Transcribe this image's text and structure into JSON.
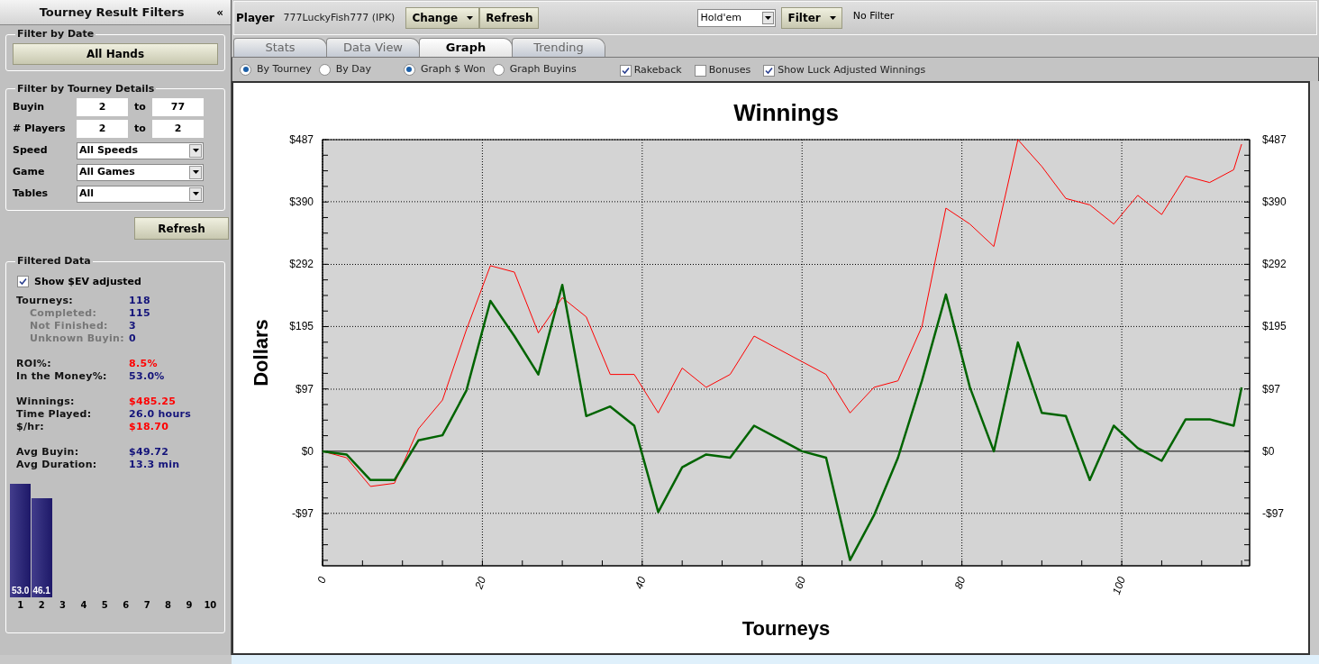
{
  "sidebar": {
    "title": "Tourney Result Filters",
    "collapse_icon": "«",
    "date_filter": {
      "legend": "Filter by Date",
      "button": "All Hands"
    },
    "details": {
      "legend": "Filter by Tourney Details",
      "ranges": [
        {
          "label": "Buyin",
          "from": "2",
          "to_label": "to",
          "to": "77"
        },
        {
          "label": "# Players",
          "from": "2",
          "to_label": "to",
          "to": "2"
        }
      ],
      "dropdowns": [
        {
          "label": "Speed",
          "value": "All Speeds"
        },
        {
          "label": "Game",
          "value": "All Games"
        },
        {
          "label": "Tables",
          "value": "All"
        }
      ]
    },
    "refresh_button": "Refresh",
    "filtered": {
      "legend": "Filtered Data",
      "ev_checkbox": {
        "label": "Show $EV adjusted",
        "checked": true
      },
      "groups": [
        [
          {
            "kind": "main",
            "label": "Tourneys:",
            "value": "118",
            "color": "#14147a"
          },
          {
            "kind": "sub",
            "label": "Completed:",
            "value": "115",
            "color": "#14147a"
          },
          {
            "kind": "sub",
            "label": "Not Finished:",
            "value": "3",
            "color": "#14147a"
          },
          {
            "kind": "sub",
            "label": "Unknown Buyin:",
            "value": "0",
            "color": "#14147a"
          }
        ],
        [
          {
            "kind": "main",
            "label": "ROI%:",
            "value": "8.5%",
            "color": "#ff0000"
          },
          {
            "kind": "main",
            "label": "In the Money%:",
            "value": "53.0%",
            "color": "#14147a"
          }
        ],
        [
          {
            "kind": "main",
            "label": "Winnings:",
            "value": "$485.25",
            "color": "#ff0000"
          },
          {
            "kind": "main",
            "label": "Time Played:",
            "value": "26.0 hours",
            "color": "#14147a"
          },
          {
            "kind": "main",
            "label": "$/hr:",
            "value": "$18.70",
            "color": "#ff0000"
          }
        ],
        [
          {
            "kind": "main",
            "label": "Avg Buyin:",
            "value": "$49.72",
            "color": "#14147a"
          },
          {
            "kind": "main",
            "label": "Avg Duration:",
            "value": "13.3 min",
            "color": "#14147a"
          }
        ]
      ],
      "chart_data": {
        "type": "bar",
        "categories": [
          "1",
          "2",
          "3",
          "4",
          "5",
          "6",
          "7",
          "8",
          "9",
          "10"
        ],
        "values": [
          53.0,
          46.1,
          null,
          null,
          null,
          null,
          null,
          null,
          null,
          null
        ],
        "value_labels": [
          "53.0",
          "46.1",
          null,
          null,
          null,
          null,
          null,
          null,
          null,
          null
        ]
      }
    }
  },
  "player_bar": {
    "label": "Player",
    "player": "777LuckyFish777 (IPK)",
    "change_button": "Change",
    "refresh_button": "Refresh",
    "game_select": "Hold'em",
    "filter_button": "Filter",
    "filter_status": "No Filter"
  },
  "tabs": [
    {
      "label": "Stats",
      "selected": false
    },
    {
      "label": "Data View",
      "selected": false
    },
    {
      "label": "Graph",
      "selected": true
    },
    {
      "label": "Trending",
      "selected": false
    }
  ],
  "radio_groups": [
    [
      {
        "label": "By Tourney",
        "selected": true
      },
      {
        "label": "By Day",
        "selected": false
      }
    ],
    [
      {
        "label": "Graph $ Won",
        "selected": true
      },
      {
        "label": "Graph Buyins",
        "selected": false
      }
    ]
  ],
  "checkboxes": [
    {
      "label": "Rakeback",
      "checked": true
    },
    {
      "label": "Bonuses",
      "checked": false
    },
    {
      "label": "Show Luck Adjusted Winnings",
      "checked": true
    }
  ],
  "graph": {
    "chart_data": {
      "type": "line",
      "title": "Winnings",
      "xlabel": "Tourneys",
      "ylabel": "Dollars",
      "x": [
        0,
        3,
        6,
        9,
        12,
        15,
        18,
        21,
        24,
        27,
        30,
        33,
        36,
        39,
        42,
        45,
        48,
        51,
        54,
        57,
        60,
        63,
        66,
        69,
        72,
        75,
        78,
        81,
        84,
        87,
        90,
        93,
        96,
        99,
        102,
        105,
        108,
        111,
        114,
        115
      ],
      "series": [
        {
          "color": "#ff0000",
          "values": [
            0,
            -10,
            -55,
            -50,
            35,
            80,
            190,
            290,
            280,
            185,
            240,
            210,
            120,
            120,
            60,
            130,
            100,
            120,
            180,
            160,
            140,
            120,
            60,
            100,
            110,
            195,
            380,
            355,
            320,
            487,
            445,
            395,
            385,
            355,
            400,
            370,
            430,
            420,
            440,
            480
          ]
        },
        {
          "color": "#006400",
          "values": [
            0,
            -5,
            -45,
            -45,
            17,
            25,
            95,
            235,
            180,
            120,
            260,
            55,
            70,
            40,
            -95,
            -25,
            -5,
            -10,
            40,
            20,
            0,
            -10,
            -170,
            -100,
            -10,
            110,
            245,
            100,
            0,
            170,
            60,
            55,
            -45,
            40,
            5,
            -15,
            50,
            50,
            40,
            100
          ]
        }
      ],
      "grid": true,
      "xlim": [
        0,
        116
      ],
      "ylim": [
        -179,
        487
      ],
      "xticks": [
        0,
        20,
        40,
        60,
        80,
        100
      ],
      "yticks": [
        {
          "value": 487,
          "label": "$487"
        },
        {
          "value": 390,
          "label": "$390"
        },
        {
          "value": 292,
          "label": "$292"
        },
        {
          "value": 195,
          "label": "$195"
        },
        {
          "value": 97,
          "label": "$97"
        },
        {
          "value": 0,
          "label": "$0"
        },
        {
          "value": -97,
          "label": "-$97"
        }
      ]
    }
  }
}
